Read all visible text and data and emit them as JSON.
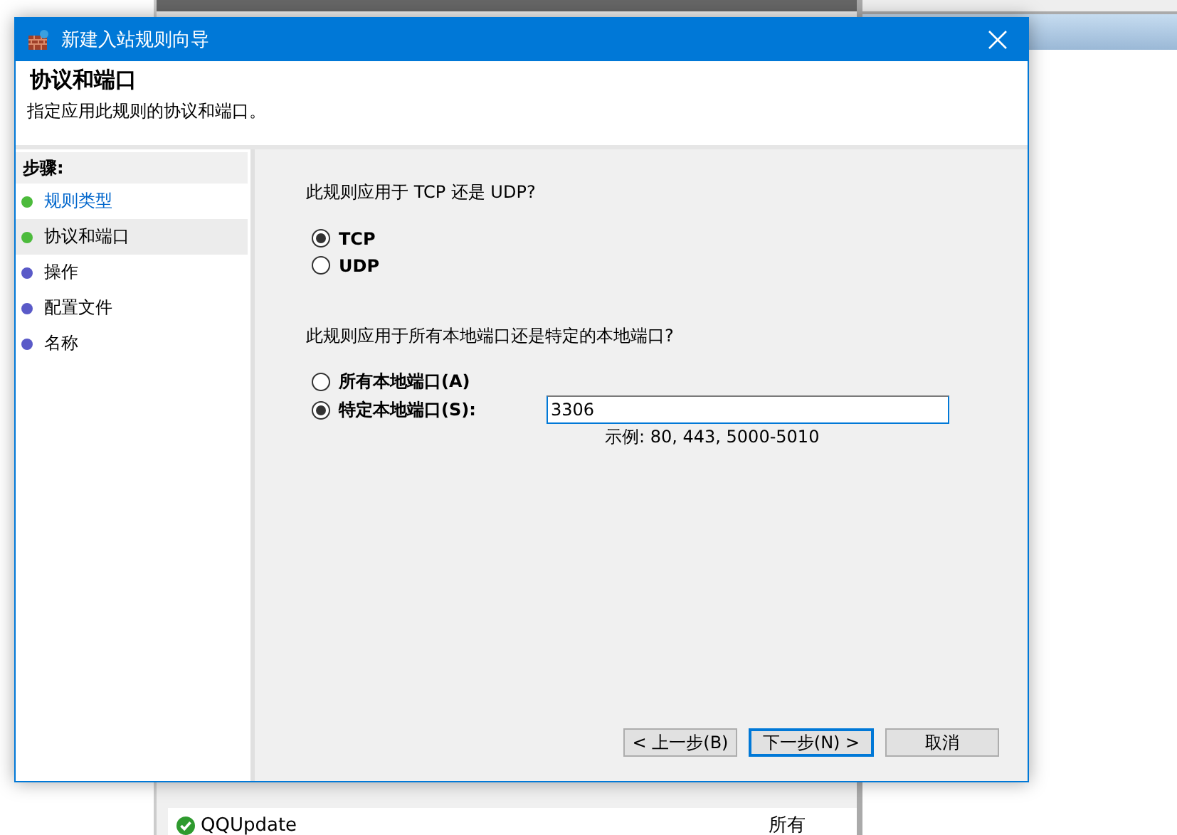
{
  "background": {
    "rows": [
      {
        "name": "QQUpdate",
        "column_2": "所有"
      }
    ]
  },
  "window": {
    "title": "新建入站规则向导"
  },
  "header": {
    "title": "协议和端口",
    "subtitle": "指定应用此规则的协议和端口。"
  },
  "steps": {
    "heading": "步骤:",
    "items": [
      {
        "label": "规则类型",
        "selected": false,
        "link": true,
        "color": "#4cbb3c"
      },
      {
        "label": "协议和端口",
        "selected": true,
        "link": false,
        "color": "#4cbb3c"
      },
      {
        "label": "操作",
        "selected": false,
        "link": false,
        "color": "#5a5ac8"
      },
      {
        "label": "配置文件",
        "selected": false,
        "link": false,
        "color": "#5a5ac8"
      },
      {
        "label": "名称",
        "selected": false,
        "link": false,
        "color": "#5a5ac8"
      }
    ]
  },
  "protocol": {
    "question": "此规则应用于 TCP 还是 UDP?",
    "options": [
      {
        "label": "TCP",
        "selected": true
      },
      {
        "label": "UDP",
        "selected": false
      }
    ]
  },
  "ports": {
    "question": "此规则应用于所有本地端口还是特定的本地端口?",
    "options": [
      {
        "label": "所有本地端口(A)",
        "selected": false
      },
      {
        "label": "特定本地端口(S):",
        "selected": true
      }
    ],
    "value": "3306",
    "example": "示例: 80, 443, 5000-5010"
  },
  "buttons": [
    {
      "label": "< 上一步(B)",
      "default": false
    },
    {
      "label": "下一步(N) >",
      "default": true
    },
    {
      "label": "取消",
      "default": false
    }
  ]
}
